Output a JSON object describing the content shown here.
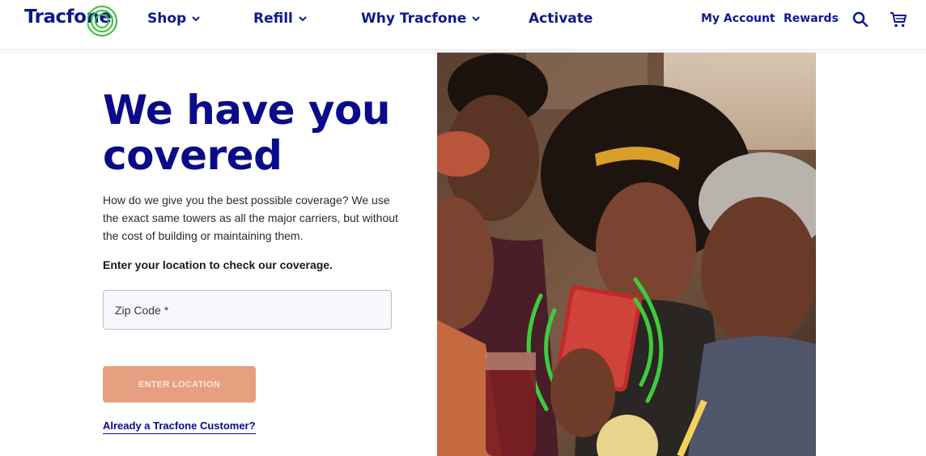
{
  "header": {
    "logo_text": "Tracfone",
    "nav": [
      {
        "label": "Shop",
        "has_dropdown": true
      },
      {
        "label": "Refill",
        "has_dropdown": true
      },
      {
        "label": "Why Tracfone",
        "has_dropdown": true
      },
      {
        "label": "Activate",
        "has_dropdown": false
      }
    ],
    "my_account": "My Account",
    "rewards": "Rewards",
    "icons": [
      "search-icon",
      "cart-icon"
    ]
  },
  "hero": {
    "title_line1": "We have you",
    "title_line2": "covered",
    "description": "How do we give you the best possible coverage? We use the exact same towers as all the major carriers, but without the cost of building or maintaining them.",
    "cta_text": "Enter your location to check our coverage.",
    "zip_placeholder": "Zip Code *",
    "zip_value": "",
    "button_label": "ENTER LOCATION",
    "customer_link": "Already a Tracfone Customer?"
  },
  "colors": {
    "brand_navy": "#0a0a8a",
    "brand_green": "#3dbb3d",
    "button_disabled": "#e6a080"
  }
}
